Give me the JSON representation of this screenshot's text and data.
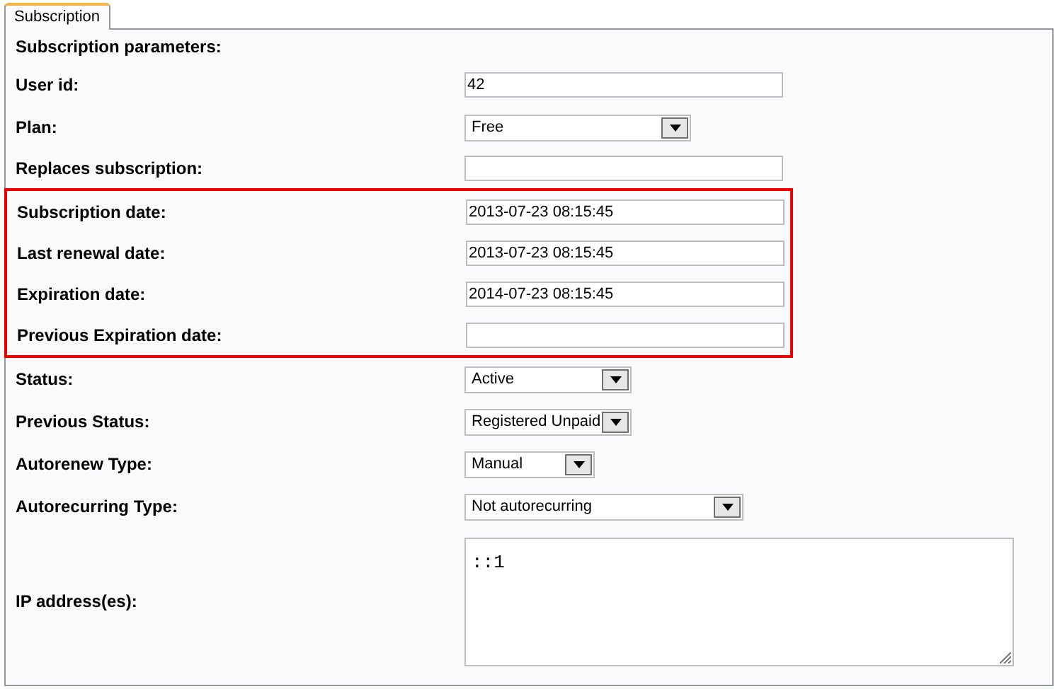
{
  "tabs": [
    {
      "label": "Subscription",
      "selected": true
    }
  ],
  "section_title": "Subscription parameters:",
  "rows": [
    {
      "kind": "text",
      "label": "User id:",
      "value": "42"
    },
    {
      "kind": "select",
      "label": "Plan:",
      "value": "Free"
    },
    {
      "kind": "text",
      "label": "Replaces subscription:"
    },
    {
      "kind": "group",
      "highlighted": true,
      "rows": [
        {
          "kind": "text",
          "label": "Subscription date:",
          "value": "2013-07-23 08:15:45"
        },
        {
          "kind": "text",
          "label": "Last renewal date:",
          "value": "2013-07-23 08:15:45"
        },
        {
          "kind": "text",
          "label": "Expiration date:",
          "value": "2014-07-23 08:15:45"
        },
        {
          "kind": "text",
          "label": "Previous Expiration date:"
        }
      ]
    },
    {
      "kind": "select",
      "label": "Status:",
      "value": "Active"
    },
    {
      "kind": "select",
      "label": "Previous Status:",
      "value": "Registered Unpaid"
    },
    {
      "kind": "select",
      "label": "Autorenew Type:",
      "value": "Manual"
    },
    {
      "kind": "select",
      "label": "Autorecurring Type:",
      "value": "Not autorecurring"
    },
    {
      "kind": "textarea",
      "label": "IP address(es):",
      "value": "::1"
    }
  ]
}
